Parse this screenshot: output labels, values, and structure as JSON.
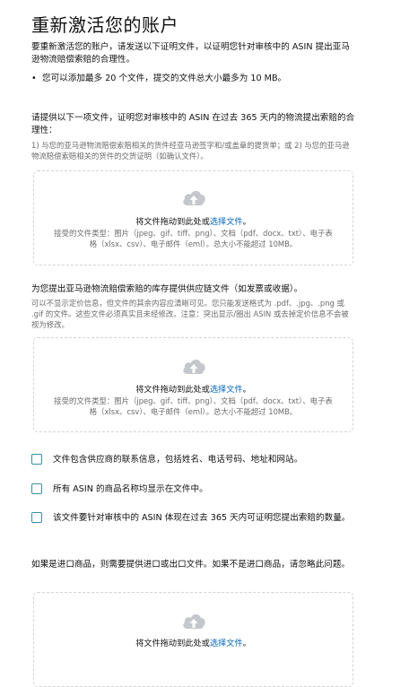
{
  "title": "重新激活您的账户",
  "intro": {
    "text": "要重新激活您的账户，请发送以下证明文件，以证明您针对审核中的 ASIN 提出亚马逊物流赔偿索赔的合理性。",
    "bullet": "您可以添加最多 20 个文件，提交的文件总大小最多为 10 MB。"
  },
  "section1": {
    "heading": "请提供以下一项文件，证明您对审核中的 ASIN 在过去 365 天内的物流提出索赔的合理性：",
    "note": "1) 与您的亚马逊物流赔偿索赔相关的货件经亚马逊签字和/或盖章的提货单；或 2) 与您的亚马逊物流赔偿索赔相关的货件的交货证明（如确认文件）。"
  },
  "dropzone": {
    "main_prefix": "将文件拖动到此处或",
    "main_link": "选择文件",
    "main_suffix": "。",
    "types": "接受的文件类型：图片（jpeg、gif、tiff、png）、文档（pdf、docx、txt）、电子表格（xlsx、csv）、电子邮件（eml）。总大小不能超过 10MB。"
  },
  "section2": {
    "heading": "为您提出亚马逊物流赔偿索赔的库存提供供应链文件（如发票或收据）。",
    "note": "可以不显示定价信息，但文件的其余内容应清晰可见。您只能发送格式为 .pdf、.jpg、.png 或 .gif 的文件。这些文件必须真实且未经修改。注意：突出显示/圈出 ASIN 或去掉定价信息不会被视为修改。"
  },
  "checkboxes": [
    "文件包含供应商的联系信息，包括姓名、电话号码、地址和网站。",
    "所有 ASIN 的商品名称均显示在文件中。",
    "该文件要针对审核中的 ASIN 体现在过去 365 天内可证明您提出索赔的数量。"
  ],
  "section3": {
    "heading": "如果是进口商品，则需要提供进口或出口文件。如果不是进口商品，请忽略此问题。"
  },
  "colors": {
    "link": "#0066c0",
    "checkbox_border": "#3b8ea5",
    "dropzone_border": "#cfd3d6",
    "upload_icon": "#c4c8cc"
  },
  "icons": {
    "upload": "cloud-upload-icon"
  }
}
